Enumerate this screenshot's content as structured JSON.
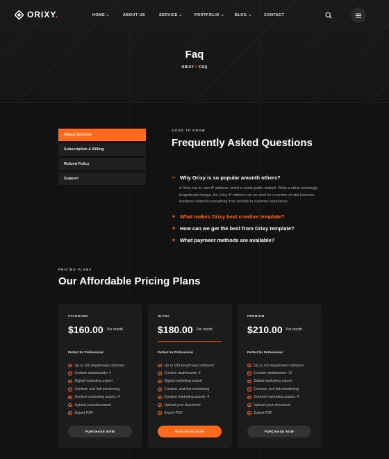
{
  "brand": {
    "name": "ORIXY",
    "dot": ".",
    "accent": "#ff6b1a"
  },
  "nav": {
    "items": [
      {
        "label": "HOME",
        "dropdown": true
      },
      {
        "label": "ABOUT US",
        "dropdown": false
      },
      {
        "label": "SERVICE",
        "dropdown": true
      },
      {
        "label": "PORTFOLIO",
        "dropdown": true
      },
      {
        "label": "BLOG",
        "dropdown": true
      },
      {
        "label": "CONTACT",
        "dropdown": false
      }
    ]
  },
  "hero": {
    "title": "Faq",
    "breadcrumb": {
      "home": "ORIXY",
      "sep": "//",
      "current": "FAQ"
    }
  },
  "faq": {
    "sidebar": [
      {
        "label": "About Services",
        "active": true
      },
      {
        "label": "Subscription & Billing",
        "active": false
      },
      {
        "label": "Refund Policy",
        "active": false
      },
      {
        "label": "Support",
        "active": false
      }
    ],
    "eyebrow": "GOOD TO KNOW",
    "title": "Frequently Asked Questions",
    "questions": [
      {
        "q": "Why Orixy is so popular amonth others?",
        "open": true,
        "sign": "−"
      },
      {
        "q": "What makes Orixy best creative template?",
        "open": false,
        "sign": "+"
      },
      {
        "q": "How can we get the best from Orixy template?",
        "open": false,
        "sign": "+"
      },
      {
        "q": "What payment methods are available?",
        "open": false,
        "sign": "+"
      }
    ],
    "answer": "A Orixy has its own IP address, which is made public instead. While a rather seemingly insignificant change, the Orixy IP address can be used for a number of vital business functions related to everything from security to customer experience."
  },
  "pricing": {
    "eyebrow": "PRICING PLANS",
    "title": "Our Affordable Pricing Plans",
    "plans": [
      {
        "name": "STANDARD",
        "price": "$160.00",
        "per": "Per month",
        "subtitle": "Perfect for Professional",
        "features": [
          "Up to 100 keyphrases otimized",
          "Custom dashboards: 4",
          "Digital marketing expert",
          "Content, and link monitoring",
          "Content marketing assets: 4",
          "Upload your document",
          "Export PDF"
        ],
        "cta": "PURCHASE NOW",
        "highlighted": false
      },
      {
        "name": "ULTRA",
        "price": "$180.00",
        "per": "Per month",
        "subtitle": "Perfect for Professional",
        "features": [
          "Up to 100 keyphrases otimized",
          "Custom dashboards: 8",
          "Digital marketing expert",
          "Content, and link monitoring",
          "Content marketing assets: 4",
          "Upload your document",
          "Export PDF"
        ],
        "cta": "PURCHASE NOW",
        "highlighted": true
      },
      {
        "name": "PREMIUM",
        "price": "$210.00",
        "per": "Per month",
        "subtitle": "Perfect for Professional",
        "features": [
          "Up to 100 keyphrases otimized",
          "Custom dashboards: 12",
          "Digital marketing expert",
          "Content, and link monitoring",
          "Content marketing assets: 4",
          "Upload your document",
          "Export PDF"
        ],
        "cta": "PURCHASE NOW",
        "highlighted": false
      }
    ]
  },
  "icons": {
    "search": "search-icon",
    "menu": "hamburger-icon",
    "check": "check-circle-icon",
    "chevron": "chevron-down-icon"
  }
}
